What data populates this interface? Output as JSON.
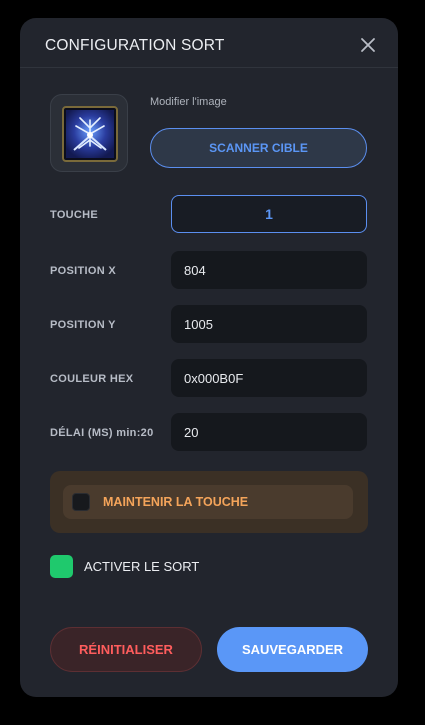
{
  "dialog": {
    "title": "CONFIGURATION SORT",
    "close_icon": "close-icon"
  },
  "image": {
    "modify_label": "Modifier l'image",
    "scan_button": "SCANNER CIBLE",
    "icon": "spell-icon"
  },
  "fields": {
    "key": {
      "label": "TOUCHE",
      "value": "1"
    },
    "pos_x": {
      "label": "POSITION X",
      "value": "804"
    },
    "pos_y": {
      "label": "POSITION Y",
      "value": "1005"
    },
    "color_hex": {
      "label": "COULEUR HEX",
      "value": "0x000B0F"
    },
    "delay": {
      "label": "DÉLAI (MS) min:20",
      "value": "20"
    }
  },
  "hold_key": {
    "label": "MAINTENIR LA TOUCHE",
    "checked": false
  },
  "activate": {
    "label": "ACTIVER LE SORT",
    "checked": true
  },
  "actions": {
    "reset": "RÉINITIALISER",
    "save": "SAUVEGARDER"
  },
  "colors": {
    "dialog_bg": "#22252d",
    "accent_blue": "#5a97f7",
    "danger_red": "#ff5d5d",
    "hold_orange": "#f4a45a",
    "active_green": "#1fc96d"
  }
}
